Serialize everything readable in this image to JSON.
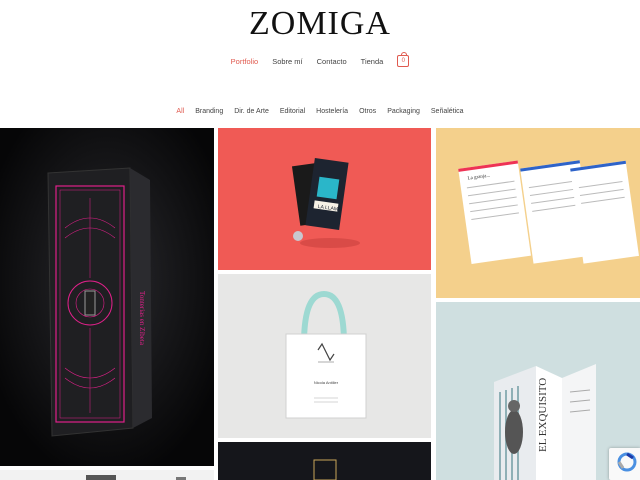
{
  "site": {
    "logo": "ZOMIGA"
  },
  "nav": {
    "items": [
      {
        "label": "Portfolio"
      },
      {
        "label": "Sobre mí"
      },
      {
        "label": "Contacto"
      },
      {
        "label": "Tienda"
      }
    ],
    "cart_count": "0"
  },
  "filters": [
    "All",
    "Branding",
    "Dir. de Arte",
    "Editorial",
    "Hostelería",
    "Otros",
    "Packaging",
    "Señalética"
  ],
  "tiles": {
    "box_text": "Tonterias en Zibeta",
    "llama_label": "LA LLAMA",
    "menu_title": "La granja...",
    "bag_name": "Nicola Antilier",
    "menu2_title": "EL EXQUISITO"
  },
  "colors": {
    "accent": "#e05a4f",
    "tile_red": "#f05a55",
    "tile_yellow": "#f4d08c",
    "tile_teal": "#cfdfe0",
    "tile_dark": "#0b0b0d"
  }
}
